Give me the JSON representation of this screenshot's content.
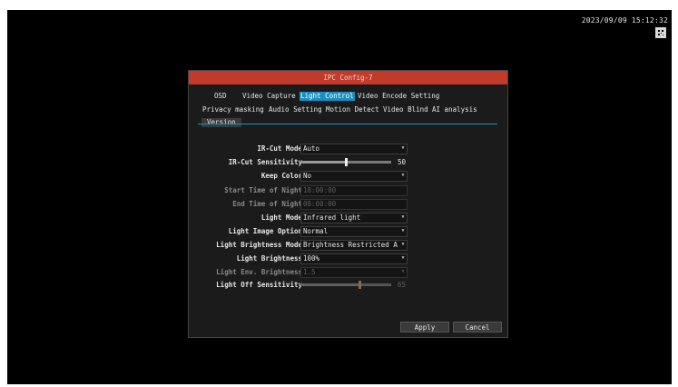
{
  "screen": {
    "clock": "2023/09/09 15:12:32",
    "qr_icon": "qr-code-icon"
  },
  "dialog": {
    "title": "IPC Config-7",
    "tabs": [
      {
        "label": "OSD",
        "active": false
      },
      {
        "label": "Video Capture",
        "active": false
      },
      {
        "label": "Light Control",
        "active": true
      },
      {
        "label": "Video Encode Setting",
        "active": false
      },
      {
        "label": "Privacy masking",
        "active": false
      },
      {
        "label": "Audio Setting",
        "active": false
      },
      {
        "label": "Motion Detect",
        "active": false
      },
      {
        "label": "Video Blind",
        "active": false
      },
      {
        "label": "AI analysis",
        "active": false
      },
      {
        "label": "Version",
        "active": false
      }
    ],
    "rows": [
      {
        "label": "IR-Cut Mode",
        "type": "select",
        "value": "Auto",
        "enabled": true
      },
      {
        "label": "IR-Cut Sensitivity",
        "type": "slider",
        "value": "50",
        "level": 0.5,
        "enabled": true
      },
      {
        "label": "Keep Color",
        "type": "select",
        "value": "No",
        "enabled": true
      },
      {
        "label": "Start Time of Night",
        "type": "time",
        "value": "18:00:00",
        "enabled": false
      },
      {
        "label": "End Time of Night",
        "type": "time",
        "value": "08:00:00",
        "enabled": false
      },
      {
        "label": "Light Mode",
        "type": "select",
        "value": "Infrared light",
        "enabled": true
      },
      {
        "label": "Light Image Option",
        "type": "select",
        "value": "Normal",
        "enabled": true
      },
      {
        "label": "Light Brightness Mode",
        "type": "select",
        "value": "Brightness Restricted A",
        "enabled": true
      },
      {
        "label": "Light Brightness",
        "type": "select",
        "value": "100%",
        "enabled": true
      },
      {
        "label": "Light Env. Brightness",
        "type": "select",
        "value": "1.5",
        "enabled": false
      },
      {
        "label": "Light Off Sensitivity",
        "type": "slider",
        "value": "65",
        "level": 0.65,
        "enabled": false
      }
    ],
    "apply_label": "Apply",
    "cancel_label": "Cancel"
  },
  "colors": {
    "title_bar": "#c23a2a",
    "active_tab": "#1a8fbf",
    "background": "#000000"
  }
}
